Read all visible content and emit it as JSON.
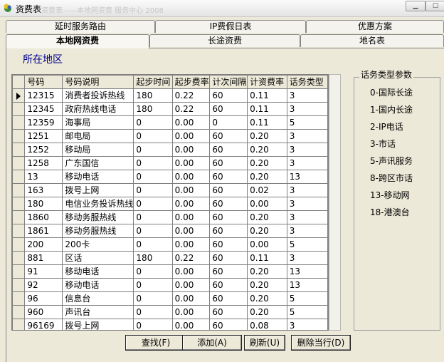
{
  "window": {
    "title": "资费表",
    "title_ghost": "资费表——本地网资费  服务中心 2008"
  },
  "tabs_row1": [
    "延时服务路由",
    "IP费假日表",
    "优惠方案"
  ],
  "tabs_row2": [
    "本地网资费",
    "长途资费",
    "地名表"
  ],
  "region_label": "所在地区",
  "grid": {
    "headers": [
      "号码",
      "号码说明",
      "起步时间",
      "起步费率",
      "计次间隔",
      "计资费率",
      "话务类型"
    ],
    "rows": [
      [
        "12315",
        "消费者投诉热线",
        "180",
        "0.22",
        "60",
        "0.11",
        "3"
      ],
      [
        "12345",
        "政府热线电话",
        "180",
        "0.22",
        "60",
        "0.11",
        "3"
      ],
      [
        "12359",
        "海事局",
        "0",
        "0.00",
        "0",
        "0.11",
        "5"
      ],
      [
        "1251",
        "邮电局",
        "0",
        "0.00",
        "60",
        "0.20",
        "3"
      ],
      [
        "1252",
        "移动局",
        "0",
        "0.00",
        "60",
        "0.20",
        "3"
      ],
      [
        "1258",
        "广东国信",
        "0",
        "0.00",
        "60",
        "0.20",
        "3"
      ],
      [
        "13",
        "移动电话",
        "0",
        "0.00",
        "60",
        "0.20",
        "13"
      ],
      [
        "163",
        "拨号上网",
        "0",
        "0.00",
        "60",
        "0.02",
        "3"
      ],
      [
        "180",
        "电信业务投诉热线",
        "0",
        "0.00",
        "60",
        "0.00",
        "3"
      ],
      [
        "1860",
        "移动务服热线",
        "0",
        "0.00",
        "60",
        "0.20",
        "3"
      ],
      [
        "1861",
        "移动务服热线",
        "0",
        "0.00",
        "60",
        "0.20",
        "3"
      ],
      [
        "200",
        "200卡",
        "0",
        "0.00",
        "60",
        "0.00",
        "5"
      ],
      [
        "881",
        "区话",
        "180",
        "0.22",
        "60",
        "0.11",
        "3"
      ],
      [
        "91",
        "移动电话",
        "0",
        "0.00",
        "60",
        "0.20",
        "13"
      ],
      [
        "92",
        "移动电话",
        "0",
        "0.00",
        "60",
        "0.20",
        "13"
      ],
      [
        "96",
        "信息台",
        "0",
        "0.00",
        "60",
        "0.20",
        "5"
      ],
      [
        "960",
        "声讯台",
        "0",
        "0.00",
        "60",
        "0.20",
        "5"
      ],
      [
        "96169",
        "拨号上网",
        "0",
        "0.00",
        "60",
        "0.08",
        "3"
      ]
    ]
  },
  "call_types": {
    "title": "话务类型参数",
    "items": [
      "0-国际长途",
      "1-国内长途",
      "2-IP电话",
      "3-市话",
      "5-声讯服务",
      "8-跨区市话",
      "13-移动网",
      "18-港澳台"
    ]
  },
  "buttons": {
    "find": "查找(F)",
    "add": "添加(A)",
    "refresh": "刷新(U)",
    "delete_row": "删除当行(D)"
  }
}
